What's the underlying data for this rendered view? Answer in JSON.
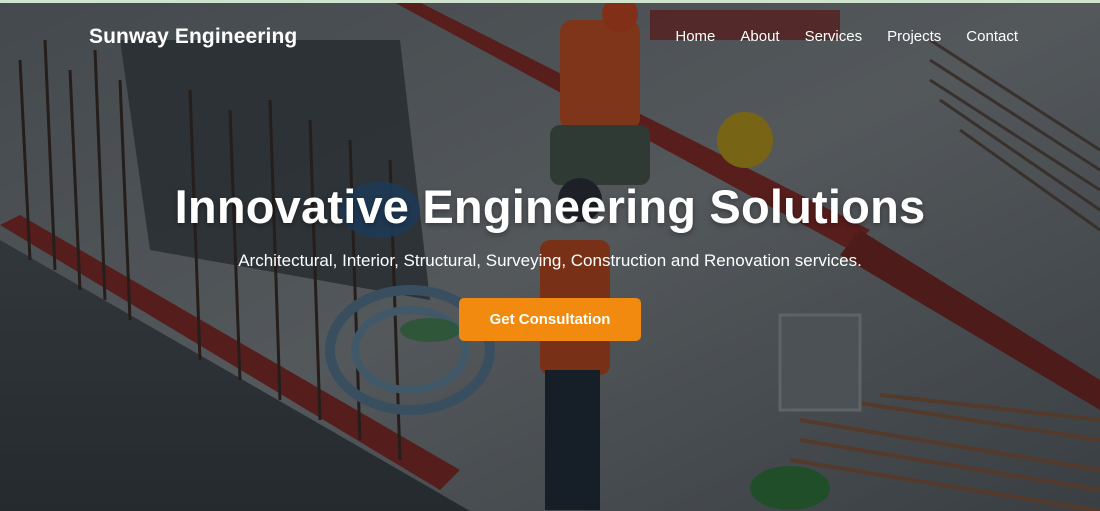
{
  "brand": {
    "name": "Sunway Engineering"
  },
  "nav": {
    "items": [
      {
        "label": "Home"
      },
      {
        "label": "About"
      },
      {
        "label": "Services"
      },
      {
        "label": "Projects"
      },
      {
        "label": "Contact"
      }
    ]
  },
  "hero": {
    "title": "Innovative Engineering Solutions",
    "subtitle": "Architectural, Interior, Structural, Surveying, Construction and Renovation services.",
    "cta_label": "Get Consultation",
    "background_icon": "construction-site-photo"
  },
  "colors": {
    "accent": "#f28a0f",
    "text": "#ffffff",
    "overlay": "#0a0e12"
  }
}
